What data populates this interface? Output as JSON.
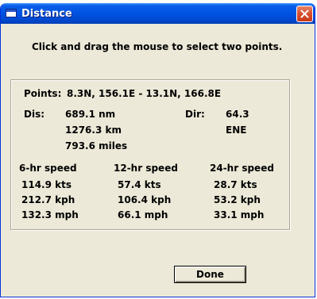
{
  "window": {
    "title": "Distance"
  },
  "instructions": "Click and drag the mouse to select two points.",
  "points": {
    "label": "Points:",
    "value": "8.3N, 156.1E  -  13.1N, 166.8E"
  },
  "distance": {
    "label": "Dis:",
    "nm": "689.1 nm",
    "km": "1276.3 km",
    "miles": "793.6 miles"
  },
  "direction": {
    "label": "Dir:",
    "degrees": "64.3",
    "compass": "ENE"
  },
  "speeds": [
    {
      "header": "6-hr speed",
      "kts": "114.9 kts",
      "kph": "212.7 kph",
      "mph": "132.3 mph"
    },
    {
      "header": "12-hr speed",
      "kts": "57.4 kts",
      "kph": "106.4 kph",
      "mph": "66.1 mph"
    },
    {
      "header": "24-hr speed",
      "kts": "28.7 kts",
      "kph": "53.2 kph",
      "mph": "33.1 mph"
    }
  ],
  "buttons": {
    "done": "Done"
  },
  "icons": {
    "app": "window-icon",
    "close": "close-icon"
  },
  "colors": {
    "titlebar": "#0054e3",
    "dialog_bg": "#ece9d8",
    "close_button": "#d9502e"
  }
}
